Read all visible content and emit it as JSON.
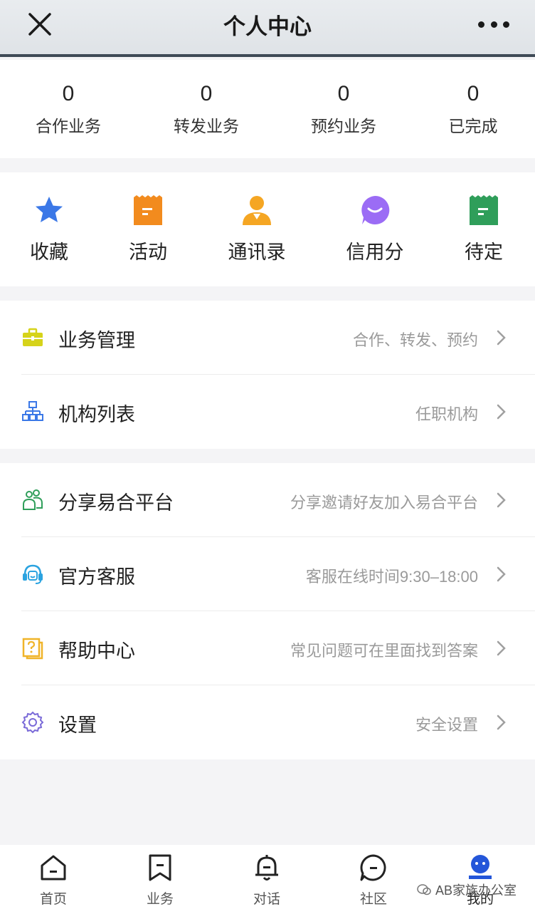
{
  "header": {
    "title": "个人中心"
  },
  "stats": [
    {
      "value": "0",
      "label": "合作业务"
    },
    {
      "value": "0",
      "label": "转发业务"
    },
    {
      "value": "0",
      "label": "预约业务"
    },
    {
      "value": "0",
      "label": "已完成"
    }
  ],
  "quick": [
    {
      "label": "收藏",
      "icon": "star-icon",
      "color": "#3b78e7"
    },
    {
      "label": "活动",
      "icon": "activity-icon",
      "color": "#f28b1e"
    },
    {
      "label": "通讯录",
      "icon": "contacts-icon",
      "color": "#f5a623"
    },
    {
      "label": "信用分",
      "icon": "credit-icon",
      "color": "#9b6cf5"
    },
    {
      "label": "待定",
      "icon": "pending-icon",
      "color": "#2f9e5a"
    }
  ],
  "group1": [
    {
      "label": "业务管理",
      "desc": "合作、转发、预约",
      "icon": "briefcase-icon"
    },
    {
      "label": "机构列表",
      "desc": "任职机构",
      "icon": "org-chart-icon"
    }
  ],
  "group2": [
    {
      "label": "分享易合平台",
      "desc": "分享邀请好友加入易合平台",
      "icon": "share-users-icon"
    },
    {
      "label": "官方客服",
      "desc": "客服在线时间9:30–18:00",
      "icon": "headset-icon"
    },
    {
      "label": "帮助中心",
      "desc": "常见问题可在里面找到答案",
      "icon": "help-icon"
    },
    {
      "label": "设置",
      "desc": "安全设置",
      "icon": "gear-icon"
    }
  ],
  "tabs": [
    {
      "label": "首页",
      "icon": "home-icon"
    },
    {
      "label": "业务",
      "icon": "bookmark-icon"
    },
    {
      "label": "对话",
      "icon": "chat-bell-icon"
    },
    {
      "label": "社区",
      "icon": "community-icon"
    },
    {
      "label": "我的",
      "icon": "profile-icon",
      "active": true
    }
  ],
  "watermark": "AB家族办公室"
}
